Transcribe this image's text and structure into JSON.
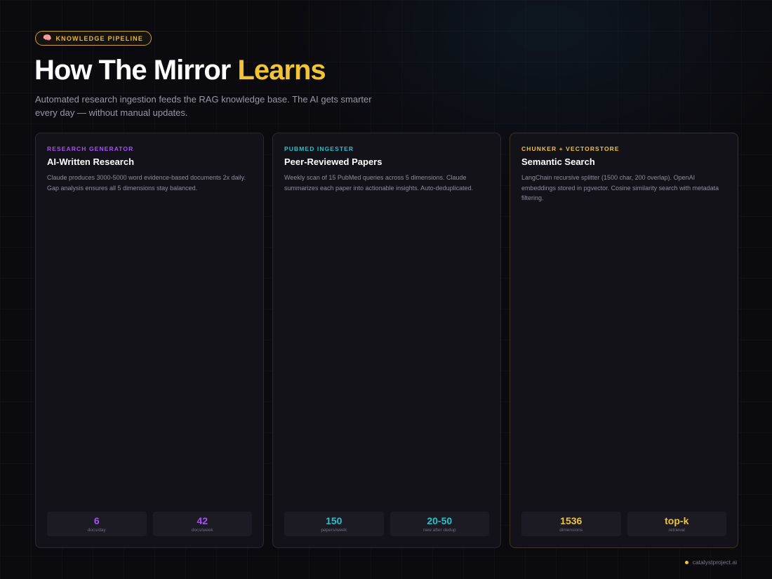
{
  "header": {
    "badge_icon": "🧠",
    "badge_label": "KNOWLEDGE PIPELINE",
    "title_main": "How The Mirror ",
    "title_accent": "Learns",
    "subtitle": "Automated research ingestion feeds the RAG knowledge base. The AI gets smarter every day — without manual updates."
  },
  "cards": [
    {
      "eyebrow": "RESEARCH GENERATOR",
      "title": "AI-Written Research",
      "description": "Claude produces 3000-5000 word evidence-based documents 2x daily. Gap analysis ensures all 5 dimensions stay balanced.",
      "stats": [
        {
          "value": "6",
          "label": "docs/day"
        },
        {
          "value": "42",
          "label": "docs/week"
        }
      ]
    },
    {
      "eyebrow": "PUBMED INGESTER",
      "title": "Peer-Reviewed Papers",
      "description": "Weekly scan of 15 PubMed queries across 5 dimensions. Claude summarizes each paper into actionable insights. Auto-deduplicated.",
      "stats": [
        {
          "value": "150",
          "label": "papers/week"
        },
        {
          "value": "20-50",
          "label": "new after dedup"
        }
      ]
    },
    {
      "eyebrow": "CHUNKER + VECTORSTORE",
      "title": "Semantic Search",
      "description": "LangChain recursive splitter (1500 char, 200 overlap). OpenAI embeddings stored in pgvector. Cosine similarity search with metadata filtering.",
      "stats": [
        {
          "value": "1536",
          "label": "dimensions"
        },
        {
          "value": "top-k",
          "label": "retrieval"
        }
      ]
    }
  ],
  "colors": {
    "purple": "#a552f5",
    "teal": "#25c2cc",
    "gold": "#f0c437"
  },
  "footer": {
    "text": "catalystproject.ai"
  }
}
